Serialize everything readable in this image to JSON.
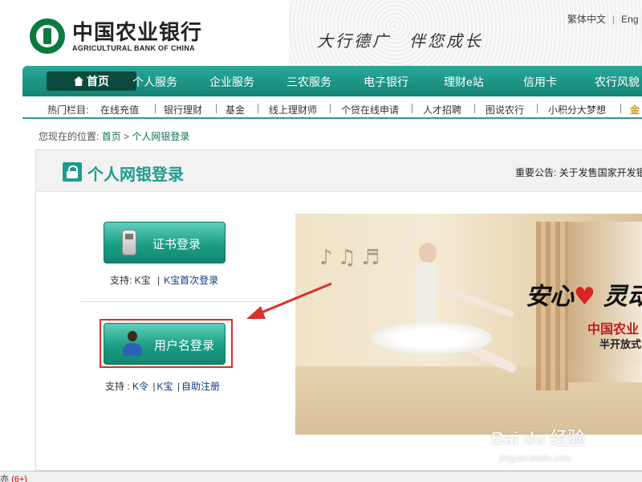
{
  "header": {
    "logo_cn": "中国农业银行",
    "logo_en": "AGRICULTURAL BANK OF CHINA",
    "slogan": "大行德广　伴您成长",
    "lang_traditional": "繁体中文",
    "lang_separator": "|",
    "lang_english": "Eng"
  },
  "nav": {
    "home": "首页",
    "items": [
      "个人服务",
      "企业服务",
      "三农服务",
      "电子银行",
      "理财e站",
      "信用卡",
      "农行风貌"
    ]
  },
  "hotbar": {
    "label": "热门栏目:",
    "items": [
      "在线充值",
      "银行理财",
      "基金",
      "线上理财师",
      "个贷在线申请",
      "人才招聘",
      "图说农行",
      "小积分大梦想",
      "金"
    ]
  },
  "breadcrumb": {
    "prefix": "您现在的位置:",
    "home": "首页",
    "sep": ">",
    "current": "个人网银登录"
  },
  "panel": {
    "title": "个人网银登录",
    "notice": "重要公告: 关于发售国家开发银"
  },
  "cert_login": {
    "label": "证书登录",
    "support_prefix": "支持: ",
    "kbao": "K宝",
    "sep": "|",
    "kbao_first": "K宝首次登录"
  },
  "user_login": {
    "label": "用户名登录",
    "support_prefix": "支持 : ",
    "kling": "K令",
    "kbao": "K宝",
    "sep": "|",
    "self_register": "自助注册"
  },
  "banner": {
    "line1_a": "安心",
    "heart": "♥",
    "line1_b": "灵动",
    "line2": "中国农业",
    "line3": "半开放式",
    "notes": "♪♫♬"
  },
  "watermark": {
    "text": "Bai du 经验",
    "sub": "jingyan.baidu.com"
  },
  "statusbar": {
    "text": "亦",
    "count": "(6+)"
  },
  "colors": {
    "brand_green": "#1f9b8d",
    "nav_dark": "#0d4a3e",
    "highlight_red": "#d8322a"
  }
}
